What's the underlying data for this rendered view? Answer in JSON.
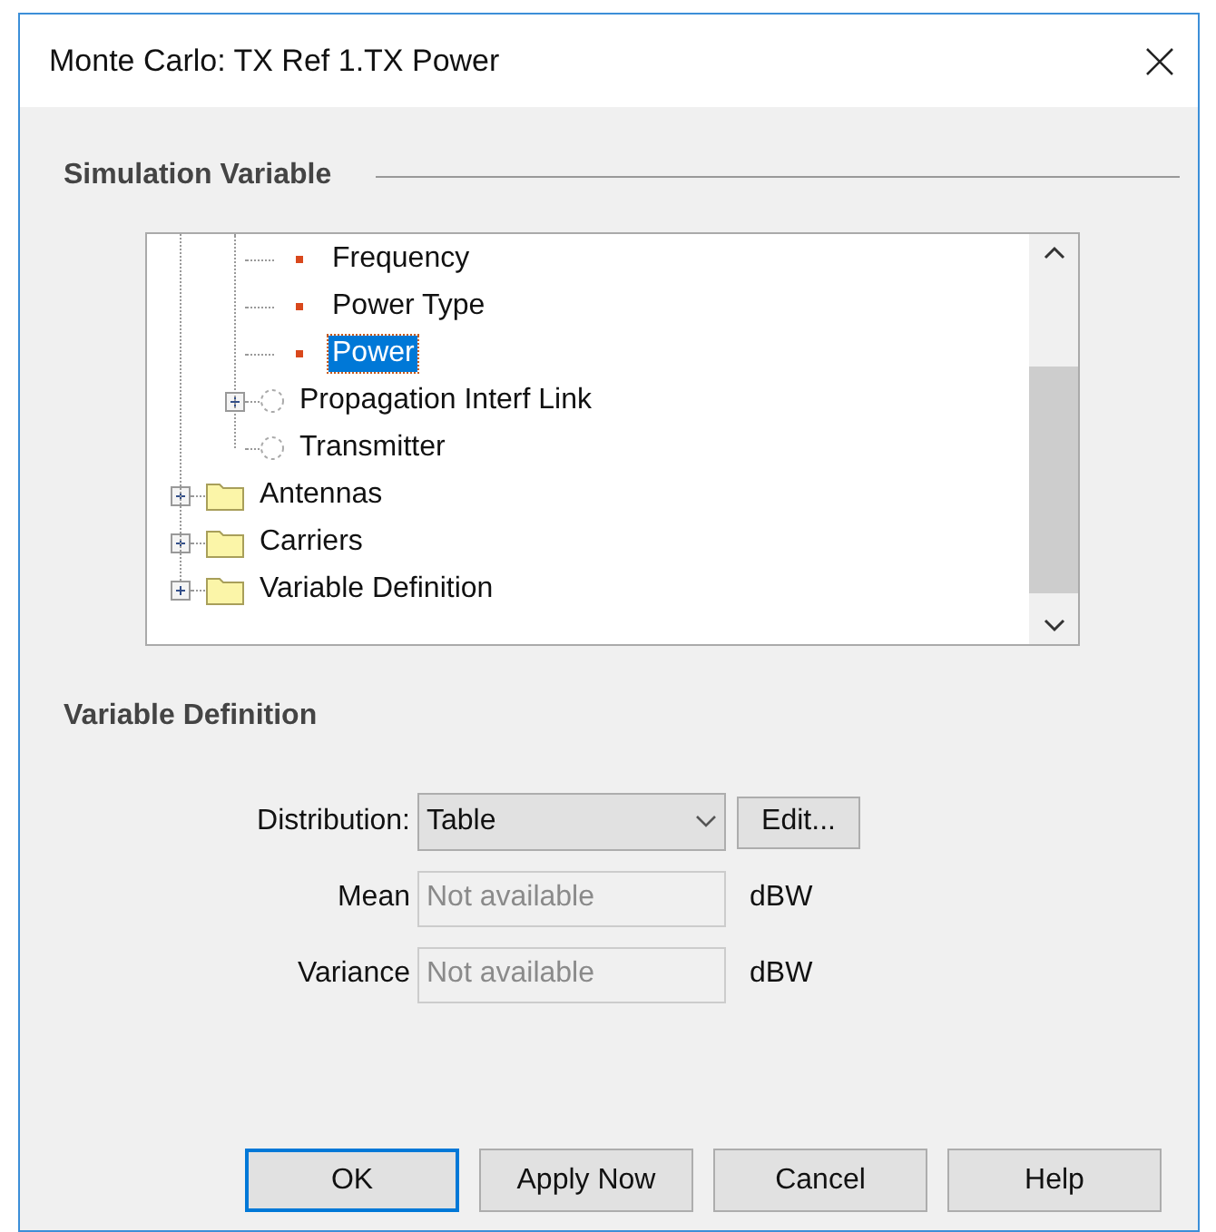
{
  "window": {
    "title": "Monte Carlo: TX Ref 1.TX Power"
  },
  "simulation_variable": {
    "heading": "Simulation Variable",
    "tree": {
      "partial_branch": [
        {
          "label": "Frequency",
          "kind": "leaf",
          "selected": false
        },
        {
          "label": "Power Type",
          "kind": "leaf",
          "selected": false
        },
        {
          "label": "Power",
          "kind": "leaf",
          "selected": true
        },
        {
          "label": "Propagation Interf Link",
          "kind": "node",
          "expanded": false,
          "selected": false
        },
        {
          "label": "Transmitter",
          "kind": "node",
          "selected": false
        }
      ],
      "items": [
        {
          "label": "Antennas",
          "kind": "folder",
          "expanded": false,
          "selected": false
        },
        {
          "label": "Carriers",
          "kind": "folder",
          "expanded": false,
          "selected": false
        },
        {
          "label": "Variable Definition",
          "kind": "folder",
          "expanded": false,
          "selected": false
        }
      ]
    }
  },
  "variable_definition": {
    "heading": "Variable Definition",
    "distribution": {
      "label": "Distribution:",
      "value": "Table",
      "edit_button": "Edit..."
    },
    "fields": [
      {
        "label": "Mean",
        "placeholder": "Not available",
        "unit": "dBW"
      },
      {
        "label": "Variance",
        "placeholder": "Not available",
        "unit": "dBW"
      }
    ]
  },
  "buttons": [
    {
      "label": "OK",
      "default": true
    },
    {
      "label": "Apply Now",
      "default": false
    },
    {
      "label": "Cancel",
      "default": false
    },
    {
      "label": "Help",
      "default": false
    }
  ]
}
